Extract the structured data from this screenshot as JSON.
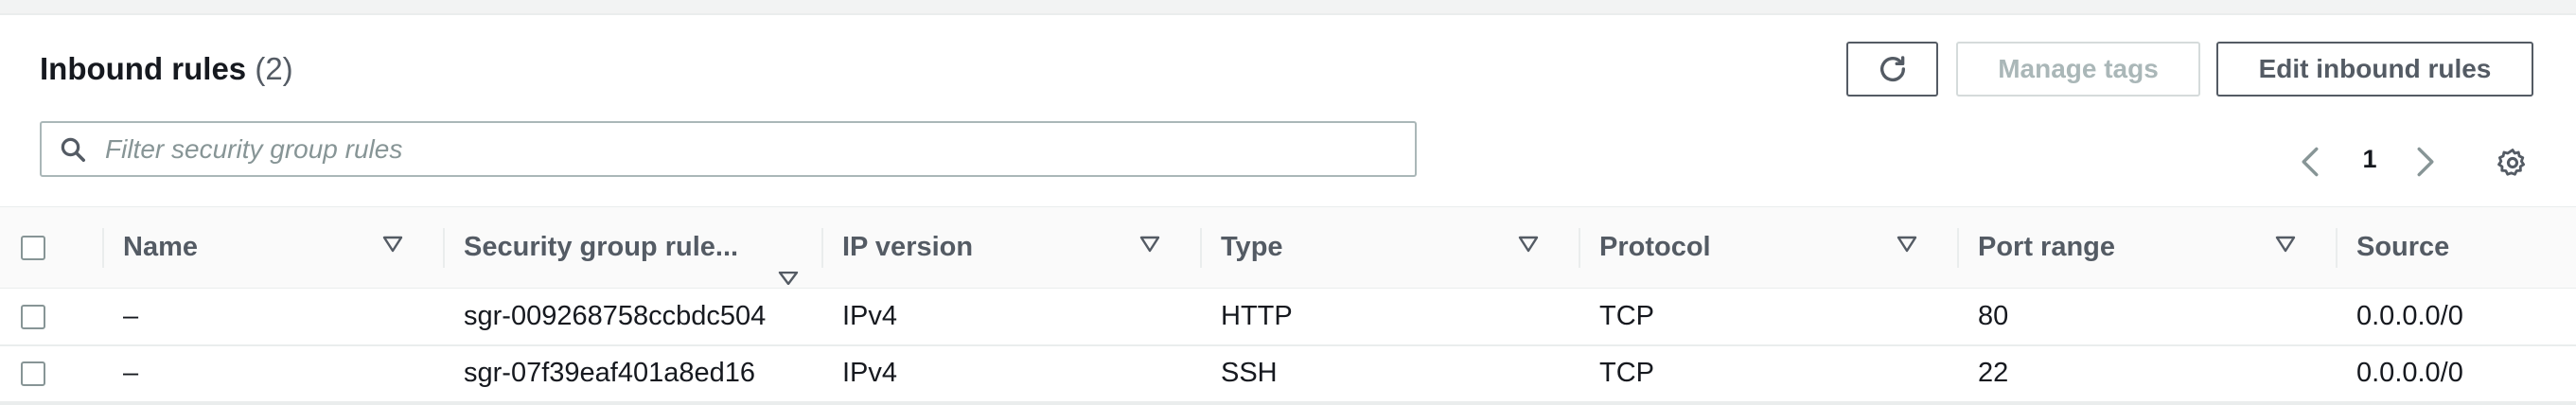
{
  "header": {
    "title": "Inbound rules",
    "count": "(2)"
  },
  "toolbar": {
    "refresh_icon": "refresh-icon",
    "manage_tags_label": "Manage tags",
    "edit_rules_label": "Edit inbound rules"
  },
  "search": {
    "placeholder": "Filter security group rules",
    "value": "",
    "icon": "search-icon"
  },
  "pagination": {
    "current_page": "1",
    "prev_icon": "chevron-left-icon",
    "next_icon": "chevron-right-icon"
  },
  "settings_icon": "gear-icon",
  "table": {
    "columns": [
      "Name",
      "Security group rule...",
      "IP version",
      "Type",
      "Protocol",
      "Port range",
      "Source"
    ],
    "rows": [
      {
        "name": "–",
        "sgr_id": "sgr-009268758ccbdc504",
        "ip_version": "IPv4",
        "type": "HTTP",
        "protocol": "TCP",
        "port_range": "80",
        "source": "0.0.0.0/0"
      },
      {
        "name": "–",
        "sgr_id": "sgr-07f39eaf401a8ed16",
        "ip_version": "IPv4",
        "type": "SSH",
        "protocol": "TCP",
        "port_range": "22",
        "source": "0.0.0.0/0"
      }
    ]
  },
  "colors": {
    "text_primary": "#16191f",
    "text_secondary": "#545b64",
    "disabled": "#aab7b8",
    "border": "#eaeded"
  }
}
